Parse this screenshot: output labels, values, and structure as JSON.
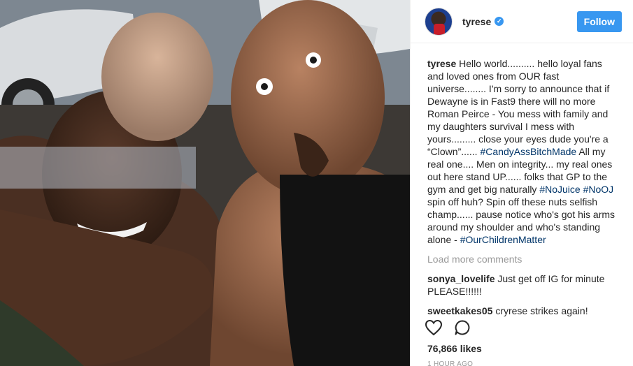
{
  "post": {
    "username": "tyrese",
    "follow_label": "Follow",
    "caption": {
      "user": "tyrese",
      "segments": [
        {
          "type": "text",
          "value": " Hello world.......... hello loyal fans and loved ones from OUR fast universe........ I'm sorry to announce that if Dewayne is in Fast9 there will no more Roman Peirce - You mess with family and my daughters survival I mess with yours......... close your eyes dude you're a “Clown”...... "
        },
        {
          "type": "tag",
          "value": "#CandyAssBitchMade"
        },
        {
          "type": "text",
          "value": " All my real one.... Men on integrity... my real ones out here stand UP...... folks that GP to the gym and get big naturally "
        },
        {
          "type": "tag",
          "value": "#NoJuice"
        },
        {
          "type": "text",
          "value": " "
        },
        {
          "type": "tag",
          "value": "#NoOJ"
        },
        {
          "type": "text",
          "value": " spin off huh? Spin off these nuts selfish champ...... pause notice who's got his arms around my shoulder and who's standing alone - "
        },
        {
          "type": "tag",
          "value": "#OurChildrenMatter"
        }
      ]
    },
    "load_more_label": "Load more comments",
    "comments": [
      {
        "user": "sonya_lovelife",
        "text": "Just get off IG for minute PLEASE!!!!!!"
      },
      {
        "user": "sweetkakes05",
        "text": "cryrese strikes again!"
      }
    ],
    "likes": "76,866 likes",
    "time_ago": "1 HOUR AGO",
    "icons": {
      "verified": "verified-badge-icon",
      "like": "heart-icon",
      "comment": "speech-bubble-icon"
    },
    "colors": {
      "accent": "#3897f0",
      "hashtag": "#003569",
      "muted": "#999999"
    }
  }
}
